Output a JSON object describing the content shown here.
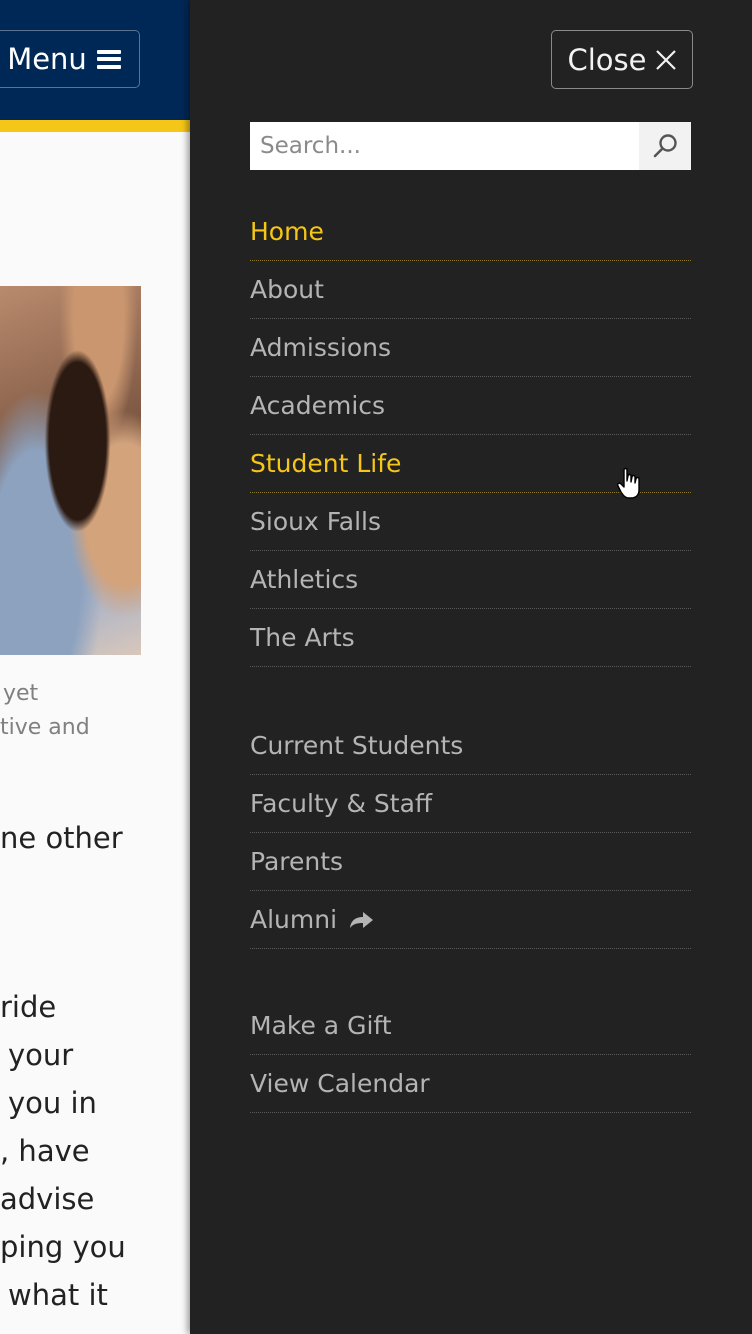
{
  "header": {
    "menu_label": "Menu",
    "menu_icon": "hamburger-icon"
  },
  "background_page": {
    "caption_lines": [
      "yet",
      "tive and"
    ],
    "body_lines": [
      "ne other",
      "ride",
      "your",
      "you in",
      ", have",
      "advise",
      "ping you",
      "what it"
    ],
    "photo_icon": "students-photo"
  },
  "drawer": {
    "close_label": "Close",
    "close_icon": "close-x-icon",
    "search": {
      "placeholder": "Search...",
      "icon": "search-icon"
    },
    "primary_nav": [
      {
        "label": "Home",
        "active": true
      },
      {
        "label": "About"
      },
      {
        "label": "Admissions"
      },
      {
        "label": "Academics"
      },
      {
        "label": "Student Life",
        "active": true
      },
      {
        "label": "Sioux Falls"
      },
      {
        "label": "Athletics"
      },
      {
        "label": "The Arts"
      }
    ],
    "secondary_nav": [
      {
        "label": "Current Students"
      },
      {
        "label": "Faculty & Staff"
      },
      {
        "label": "Parents"
      },
      {
        "label": "Alumni",
        "icon": "external-arrow-icon"
      }
    ],
    "tertiary_nav": [
      {
        "label": "Make a Gift"
      },
      {
        "label": "View Calendar"
      }
    ]
  },
  "colors": {
    "navy": "#002856",
    "gold": "#f5c518",
    "drawer_bg": "#222222",
    "nav_text": "#b4b4b4"
  }
}
